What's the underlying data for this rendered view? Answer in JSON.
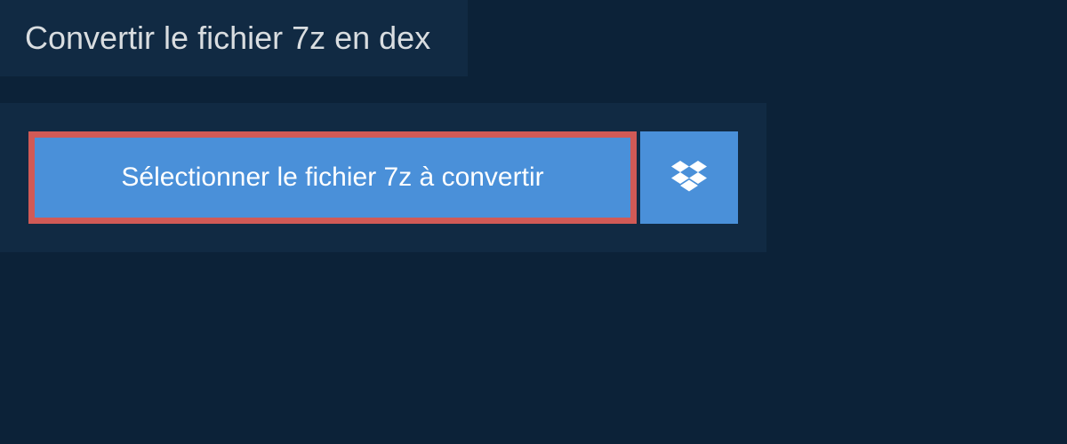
{
  "tab": {
    "title": "Convertir le fichier 7z en dex"
  },
  "actions": {
    "select_file_label": "Sélectionner le fichier 7z à convertir"
  },
  "colors": {
    "background_dark": "#0c2238",
    "panel_dark": "#112a43",
    "button_blue": "#4a90d9",
    "highlight_red": "#d15a56",
    "text_light": "#d9dde0",
    "text_white": "#ffffff"
  }
}
